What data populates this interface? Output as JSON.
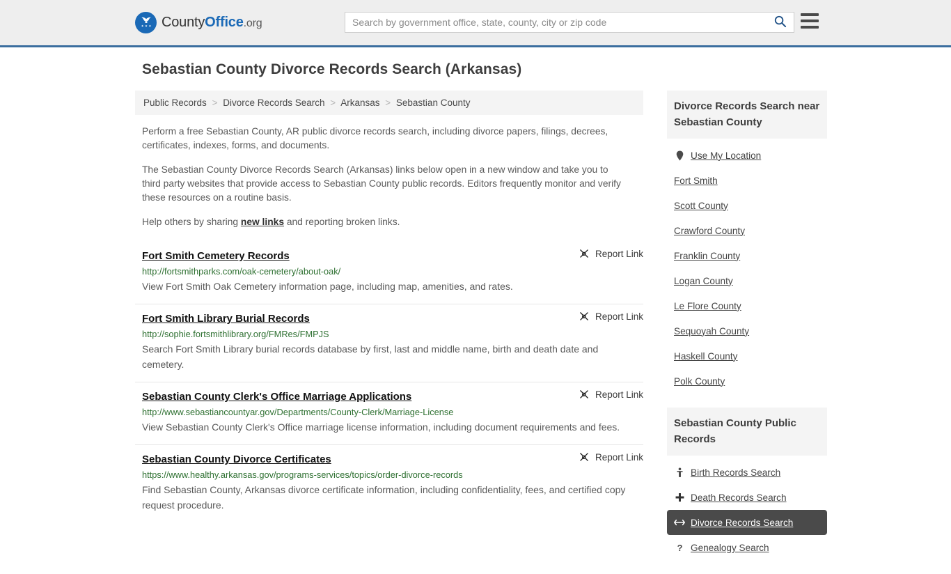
{
  "header": {
    "logo": {
      "text_part1": "County",
      "text_part2": "Office",
      "text_part3": ".org",
      "icon": "eagle-stars-seal-icon"
    },
    "search": {
      "placeholder": "Search by government office, state, county, city or zip code",
      "value": "",
      "search_icon": "search-icon"
    },
    "menu_icon": "hamburger-menu-icon"
  },
  "page": {
    "title": "Sebastian County Divorce Records Search (Arkansas)"
  },
  "breadcrumb": {
    "separator": ">",
    "items": [
      {
        "label": "Public Records"
      },
      {
        "label": "Divorce Records Search"
      },
      {
        "label": "Arkansas"
      },
      {
        "label": "Sebastian County"
      }
    ]
  },
  "intro": {
    "paragraph1": "Perform a free Sebastian County, AR public divorce records search, including divorce papers, filings, decrees, certificates, indexes, forms, and documents.",
    "paragraph2": "The Sebastian County Divorce Records Search (Arkansas) links below open in a new window and take you to third party websites that provide access to Sebastian County public records. Editors frequently monitor and verify these resources on a routine basis.",
    "paragraph3_before": "Help others by sharing ",
    "paragraph3_link": "new links",
    "paragraph3_after": " and reporting broken links."
  },
  "results": {
    "report_label": "Report Link",
    "report_icon": "broken-link-icon",
    "items": [
      {
        "title": "Fort Smith Cemetery Records",
        "url": "http://fortsmithparks.com/oak-cemetery/about-oak/",
        "description": "View Fort Smith Oak Cemetery information page, including map, amenities, and rates."
      },
      {
        "title": "Fort Smith Library Burial Records",
        "url": "http://sophie.fortsmithlibrary.org/FMRes/FMPJS",
        "description": "Search Fort Smith Library burial records database by first, last and middle name, birth and death date and cemetery."
      },
      {
        "title": "Sebastian County Clerk's Office Marriage Applications",
        "url": "http://www.sebastiancountyar.gov/Departments/County-Clerk/Marriage-License",
        "description": "View Sebastian County Clerk's Office marriage license information, including document requirements and fees."
      },
      {
        "title": "Sebastian County Divorce Certificates",
        "url": "https://www.healthy.arkansas.gov/programs-services/topics/order-divorce-records",
        "description": "Find Sebastian County, Arkansas divorce certificate information, including confidentiality, fees, and certified copy request procedure."
      }
    ]
  },
  "sidebar": {
    "nearby": {
      "heading": "Divorce Records Search near Sebastian County",
      "items": [
        {
          "label": "Use My Location",
          "icon": "map-pin-icon"
        },
        {
          "label": "Fort Smith",
          "icon": ""
        },
        {
          "label": "Scott County",
          "icon": ""
        },
        {
          "label": "Crawford County",
          "icon": ""
        },
        {
          "label": "Franklin County",
          "icon": ""
        },
        {
          "label": "Logan County",
          "icon": ""
        },
        {
          "label": "Le Flore County",
          "icon": ""
        },
        {
          "label": "Sequoyah County",
          "icon": ""
        },
        {
          "label": "Haskell County",
          "icon": ""
        },
        {
          "label": "Polk County",
          "icon": ""
        }
      ]
    },
    "public_records": {
      "heading": "Sebastian County Public Records",
      "items": [
        {
          "label": "Birth Records Search",
          "icon": "baby-icon",
          "active": false
        },
        {
          "label": "Death Records Search",
          "icon": "cross-icon",
          "active": false
        },
        {
          "label": "Divorce Records Search",
          "icon": "split-arrows-icon",
          "active": true
        },
        {
          "label": "Genealogy Search",
          "icon": "question-mark-icon",
          "active": false
        }
      ]
    }
  },
  "colors": {
    "brand_blue": "#1a69b6",
    "header_border": "#3b6e9e",
    "url_green": "#2e7031",
    "active_bg": "#4a4a4a",
    "panel_gray": "#f4f4f4"
  }
}
